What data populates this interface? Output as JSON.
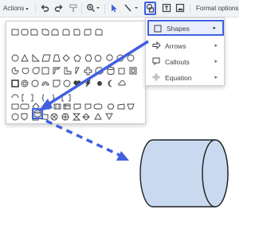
{
  "toolbar": {
    "actions_label": "Actions",
    "format_options_label": "Format options",
    "tools": [
      "undo-icon",
      "redo-icon",
      "paint-format-icon",
      "zoom-icon",
      "select-icon",
      "line-icon",
      "shape-icon",
      "text-box-icon",
      "image-icon"
    ]
  },
  "menu": {
    "items": [
      {
        "label": "Shapes",
        "icon": "square-icon"
      },
      {
        "label": "Arrows",
        "icon": "arrow-icon"
      },
      {
        "label": "Callouts",
        "icon": "callout-icon"
      },
      {
        "label": "Equation",
        "icon": "plus-icon"
      }
    ],
    "submenu_indicator": "▸"
  },
  "palette": {
    "highlighted_shape": "can-icon"
  },
  "colors": {
    "highlight": "#4060e0",
    "cylinder_fill": "#c9daf0",
    "toolbar_bg": "#f1f3f4"
  }
}
